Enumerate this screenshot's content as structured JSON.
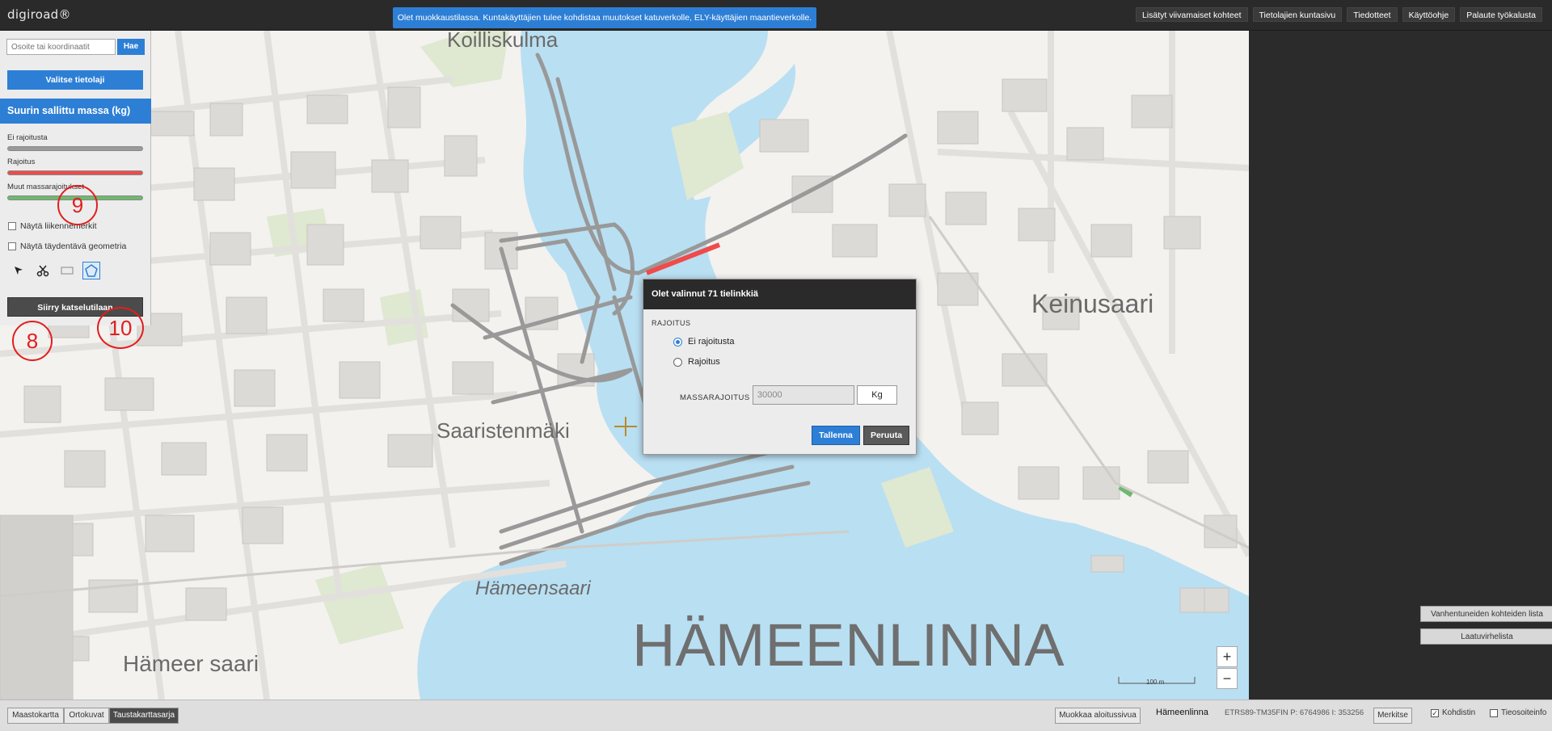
{
  "app": {
    "logo": "digiroad®",
    "notice": "Olet muokkaustilassa. Kuntakäyttäjien tulee kohdistaa muutokset katuverkolle, ELY-käyttäjien maantieverkolle."
  },
  "topnav": [
    "Lisätyt viivamaiset kohteet",
    "Tietolajien kuntasivu",
    "Tiedotteet",
    "Käyttöohje",
    "Palaute työkalusta"
  ],
  "leftpanel": {
    "search_placeholder": "Osoite tai koordinaatit",
    "search_button": "Hae",
    "layer_button": "Valitse tietolaji",
    "layer_title": "Suurin sallittu massa (kg)",
    "legend": [
      {
        "label": "Ei rajoitusta",
        "color": "#9a9a9a"
      },
      {
        "label": "Rajoitus",
        "color": "#f04b4b"
      },
      {
        "label": "Muut massarajoitukset",
        "color": "#6fb86f"
      }
    ],
    "checkboxes": [
      "Näytä liikennemerkit",
      "Näytä täydentävä geometria"
    ],
    "tools": [
      "select-tool",
      "cut-tool",
      "rectangle-tool",
      "polygon-tool"
    ],
    "viewmode_button": "Siirry katselutilaan"
  },
  "annotations": [
    "9",
    "8",
    "10"
  ],
  "map": {
    "labels": {
      "koilliskulma": "Koilliskulma",
      "keinusaari": "Keinusaari",
      "saaristenmaki": "Saaristenmäki",
      "hameensaari": "Hämeensaari",
      "hameenlinna": "HÄMEENLINNA",
      "hameensaari2": "Hämeer saari"
    },
    "scale": "100 m",
    "zoom_in": "+",
    "zoom_out": "−"
  },
  "dialog": {
    "title": "Olet valinnut 71 tielinkkiä",
    "section": "RAJOITUS",
    "option_none": "Ei rajoitusta",
    "option_limit": "Rajoitus",
    "selected": "Ei rajoitusta",
    "mass_label": "MASSARAJOITUS",
    "mass_value": "30000",
    "mass_unit": "Kg",
    "save": "Tallenna",
    "cancel": "Peruuta"
  },
  "rightpanel": {
    "outdated": "Vanhentuneiden kohteiden lista",
    "quality": "Laatuvirhelista"
  },
  "bottombar": {
    "basemaps": [
      "Maastokartta",
      "Ortokuvat",
      "Taustakarttasarja"
    ],
    "active_basemap": "Taustakarttasarja",
    "edit_start": "Muokkaa aloitussivua",
    "municipality": "Hämeenlinna",
    "coords": "ETRS89-TM35FIN  P: 6764986  I: 353256",
    "mark_button": "Merkitse",
    "crosshair": "Kohdistin",
    "roadinfo": "Tieosoiteinfo"
  }
}
